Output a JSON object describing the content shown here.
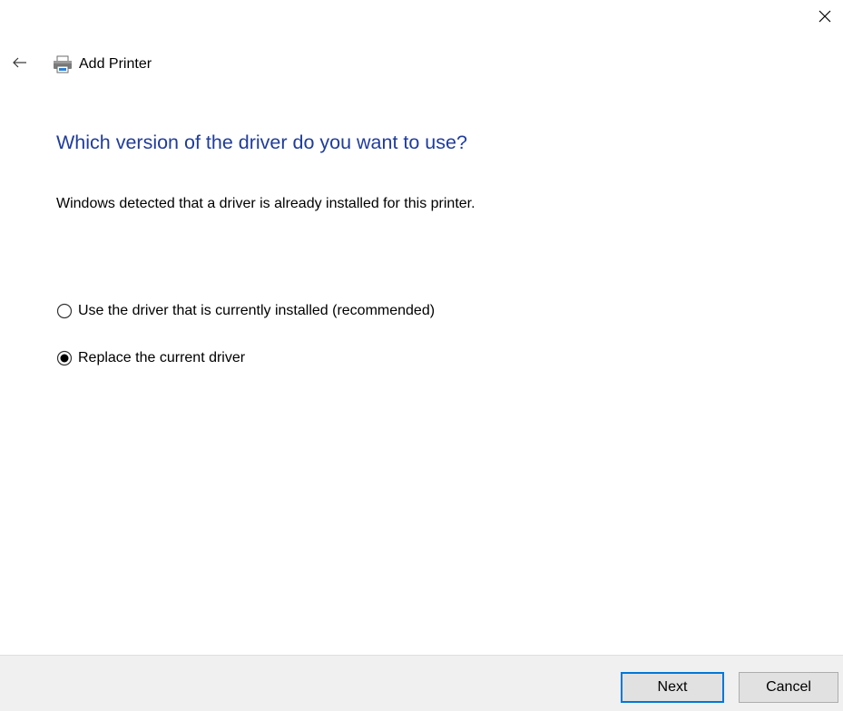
{
  "window": {
    "title": "Add Printer",
    "close_icon": "close-icon",
    "back_icon": "back-arrow-icon",
    "printer_icon": "printer-icon"
  },
  "main": {
    "heading": "Which version of the driver do you want to use?",
    "description": "Windows detected that a driver is already installed for this printer.",
    "options": [
      {
        "label": "Use the driver that is currently installed (recommended)",
        "selected": false
      },
      {
        "label": "Replace the current driver",
        "selected": true
      }
    ]
  },
  "footer": {
    "next_label": "Next",
    "cancel_label": "Cancel"
  },
  "colors": {
    "heading": "#1f3c9e",
    "focus_border": "#0078d7",
    "footer_bg": "#f0f0f0"
  }
}
